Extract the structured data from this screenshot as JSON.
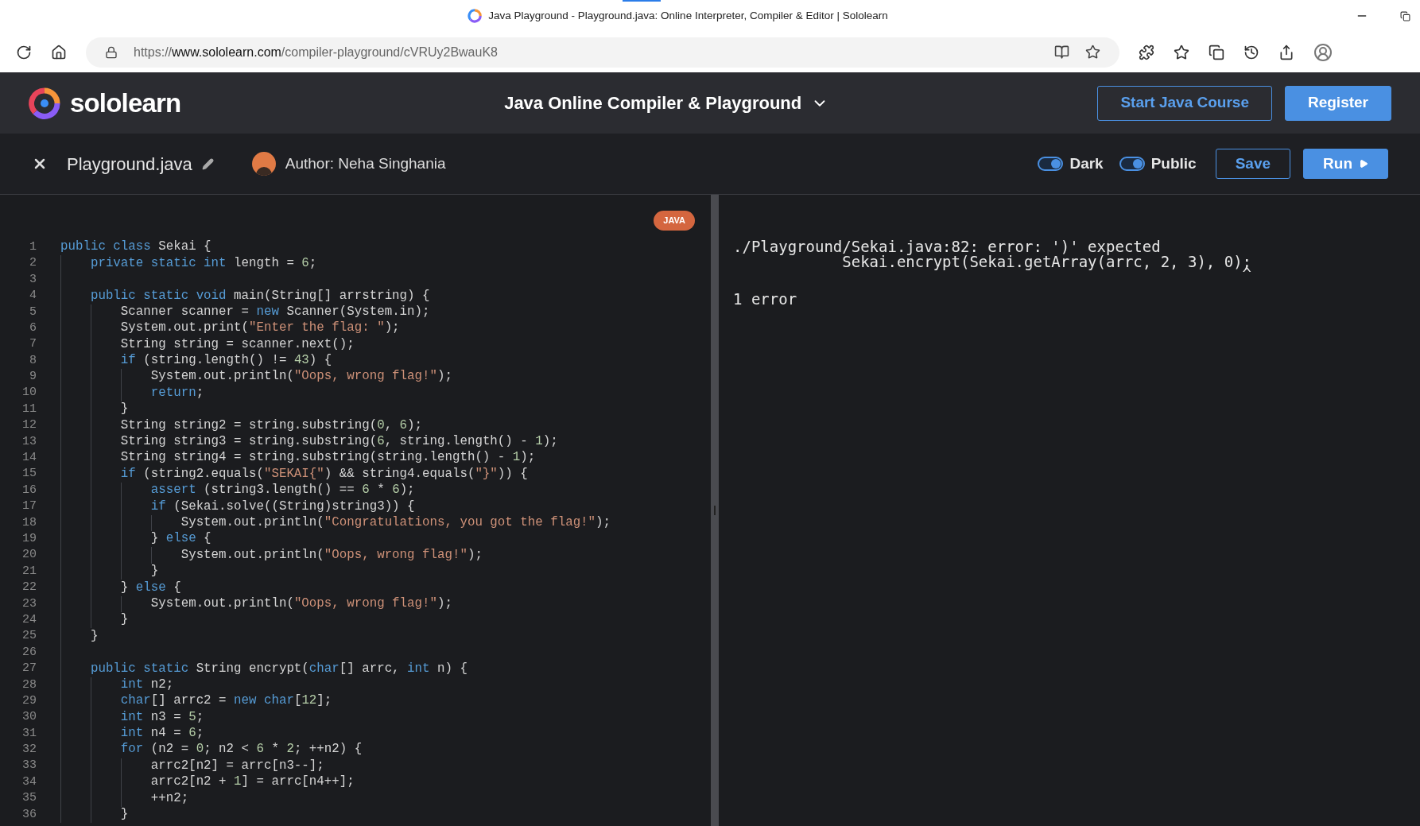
{
  "browser": {
    "title": "Java Playground - Playground.java: Online Interpreter, Compiler & Editor | Sololearn",
    "url_prefix": "https://",
    "url_host": "www.sololearn.com",
    "url_path": "/compiler-playground/cVRUy2BwauK8"
  },
  "header": {
    "brand": "sololearn",
    "title": "Java Online Compiler & Playground",
    "buttons": [
      {
        "label": "Start Java Course",
        "kind": "outline"
      },
      {
        "label": "Register",
        "kind": "filled"
      }
    ]
  },
  "toolbar": {
    "file_name": "Playground.java",
    "author": "Author: Neha Singhania",
    "toggles": [
      {
        "label": "Dark",
        "on": true
      },
      {
        "label": "Public",
        "on": true
      }
    ],
    "buttons": [
      {
        "label": "Save",
        "kind": "outline"
      },
      {
        "label": "Run",
        "kind": "filled"
      }
    ]
  },
  "editor": {
    "language_badge": "JAVA",
    "lines": [
      {
        "number": "1",
        "tokens": [
          {
            "kind": "keyword",
            "text": "public class"
          },
          {
            "kind": "text",
            "text": " Sekai {"
          }
        ]
      },
      {
        "number": "2",
        "tokens": [
          {
            "kind": "keyword",
            "text": "    private static int"
          },
          {
            "kind": "text",
            "text": " length = "
          },
          {
            "kind": "number",
            "text": "6"
          },
          {
            "kind": "text",
            "text": ";"
          }
        ]
      },
      {
        "number": "3"
      },
      {
        "number": "4",
        "tokens": [
          {
            "kind": "keyword",
            "text": "    public static void"
          },
          {
            "kind": "text",
            "text": " main(String[] arrstring) {"
          }
        ]
      },
      {
        "number": "5",
        "tokens": [
          {
            "kind": "text",
            "text": "        Scanner scanner = "
          },
          {
            "kind": "keyword",
            "text": "new"
          },
          {
            "kind": "text",
            "text": " Scanner(System.in);"
          }
        ]
      },
      {
        "number": "6",
        "tokens": [
          {
            "kind": "text",
            "text": "        System.out.print("
          },
          {
            "kind": "string",
            "text": "\"Enter the flag: \""
          },
          {
            "kind": "text",
            "text": ");"
          }
        ]
      },
      {
        "number": "7",
        "tokens": [
          {
            "kind": "text",
            "text": "        String string = scanner.next();"
          }
        ]
      },
      {
        "number": "8",
        "tokens": [
          {
            "kind": "keyword",
            "text": "        if"
          },
          {
            "kind": "text",
            "text": " (string.length() != "
          },
          {
            "kind": "number",
            "text": "43"
          },
          {
            "kind": "text",
            "text": ") {"
          }
        ]
      },
      {
        "number": "9",
        "tokens": [
          {
            "kind": "text",
            "text": "            System.out.println("
          },
          {
            "kind": "string",
            "text": "\"Oops, wrong flag!\""
          },
          {
            "kind": "text",
            "text": ");"
          }
        ]
      },
      {
        "number": "10",
        "tokens": [
          {
            "kind": "keyword",
            "text": "            return"
          },
          {
            "kind": "text",
            "text": ";"
          }
        ]
      },
      {
        "number": "11",
        "tokens": [
          {
            "kind": "text",
            "text": "        }"
          }
        ]
      },
      {
        "number": "12",
        "tokens": [
          {
            "kind": "text",
            "text": "        String string2 = string.substring("
          },
          {
            "kind": "number",
            "text": "0"
          },
          {
            "kind": "text",
            "text": ", "
          },
          {
            "kind": "number",
            "text": "6"
          },
          {
            "kind": "text",
            "text": ");"
          }
        ]
      },
      {
        "number": "13",
        "tokens": [
          {
            "kind": "text",
            "text": "        String string3 = string.substring("
          },
          {
            "kind": "number",
            "text": "6"
          },
          {
            "kind": "text",
            "text": ", string.length() - "
          },
          {
            "kind": "number",
            "text": "1"
          },
          {
            "kind": "text",
            "text": ");"
          }
        ]
      },
      {
        "number": "14",
        "tokens": [
          {
            "kind": "text",
            "text": "        String string4 = string.substring(string.length() - "
          },
          {
            "kind": "number",
            "text": "1"
          },
          {
            "kind": "text",
            "text": ");"
          }
        ]
      },
      {
        "number": "15",
        "tokens": [
          {
            "kind": "keyword",
            "text": "        if"
          },
          {
            "kind": "text",
            "text": " (string2.equals("
          },
          {
            "kind": "string",
            "text": "\"SEKAI{\""
          },
          {
            "kind": "text",
            "text": ") && string4.equals("
          },
          {
            "kind": "string",
            "text": "\"}\""
          },
          {
            "kind": "text",
            "text": ")) {"
          }
        ]
      },
      {
        "number": "16",
        "tokens": [
          {
            "kind": "keyword",
            "text": "            assert"
          },
          {
            "kind": "text",
            "text": " (string3.length() == "
          },
          {
            "kind": "number",
            "text": "6"
          },
          {
            "kind": "text",
            "text": " * "
          },
          {
            "kind": "number",
            "text": "6"
          },
          {
            "kind": "text",
            "text": ");"
          }
        ]
      },
      {
        "number": "17",
        "tokens": [
          {
            "kind": "keyword",
            "text": "            if"
          },
          {
            "kind": "text",
            "text": " (Sekai.solve((String)string3)) {"
          }
        ]
      },
      {
        "number": "18",
        "tokens": [
          {
            "kind": "text",
            "text": "                System.out.println("
          },
          {
            "kind": "string",
            "text": "\"Congratulations, you got the flag!\""
          },
          {
            "kind": "text",
            "text": ");"
          }
        ]
      },
      {
        "number": "19",
        "tokens": [
          {
            "kind": "text",
            "text": "            } "
          },
          {
            "kind": "keyword",
            "text": "else"
          },
          {
            "kind": "text",
            "text": " {"
          }
        ]
      },
      {
        "number": "20",
        "tokens": [
          {
            "kind": "text",
            "text": "                System.out.println("
          },
          {
            "kind": "string",
            "text": "\"Oops, wrong flag!\""
          },
          {
            "kind": "text",
            "text": ");"
          }
        ]
      },
      {
        "number": "21",
        "tokens": [
          {
            "kind": "text",
            "text": "            }"
          }
        ]
      },
      {
        "number": "22",
        "tokens": [
          {
            "kind": "text",
            "text": "        } "
          },
          {
            "kind": "keyword",
            "text": "else"
          },
          {
            "kind": "text",
            "text": " {"
          }
        ]
      },
      {
        "number": "23",
        "tokens": [
          {
            "kind": "text",
            "text": "            System.out.println("
          },
          {
            "kind": "string",
            "text": "\"Oops, wrong flag!\""
          },
          {
            "kind": "text",
            "text": ");"
          }
        ]
      },
      {
        "number": "24",
        "tokens": [
          {
            "kind": "text",
            "text": "        }"
          }
        ]
      },
      {
        "number": "25",
        "tokens": [
          {
            "kind": "text",
            "text": "    }"
          }
        ]
      },
      {
        "number": "26"
      },
      {
        "number": "27",
        "tokens": [
          {
            "kind": "keyword",
            "text": "    public static"
          },
          {
            "kind": "text",
            "text": " String encrypt("
          },
          {
            "kind": "keyword",
            "text": "char"
          },
          {
            "kind": "text",
            "text": "[] arrc, "
          },
          {
            "kind": "keyword",
            "text": "int"
          },
          {
            "kind": "text",
            "text": " n) {"
          }
        ]
      },
      {
        "number": "28",
        "tokens": [
          {
            "kind": "keyword",
            "text": "        int"
          },
          {
            "kind": "text",
            "text": " n2;"
          }
        ]
      },
      {
        "number": "29",
        "tokens": [
          {
            "kind": "keyword",
            "text": "        char"
          },
          {
            "kind": "text",
            "text": "[] arrc2 = "
          },
          {
            "kind": "keyword",
            "text": "new char"
          },
          {
            "kind": "text",
            "text": "["
          },
          {
            "kind": "number",
            "text": "12"
          },
          {
            "kind": "text",
            "text": "];"
          }
        ]
      },
      {
        "number": "30",
        "tokens": [
          {
            "kind": "keyword",
            "text": "        int"
          },
          {
            "kind": "text",
            "text": " n3 = "
          },
          {
            "kind": "number",
            "text": "5"
          },
          {
            "kind": "text",
            "text": ";"
          }
        ]
      },
      {
        "number": "31",
        "tokens": [
          {
            "kind": "keyword",
            "text": "        int"
          },
          {
            "kind": "text",
            "text": " n4 = "
          },
          {
            "kind": "number",
            "text": "6"
          },
          {
            "kind": "text",
            "text": ";"
          }
        ]
      },
      {
        "number": "32",
        "tokens": [
          {
            "kind": "keyword",
            "text": "        for"
          },
          {
            "kind": "text",
            "text": " (n2 = "
          },
          {
            "kind": "number",
            "text": "0"
          },
          {
            "kind": "text",
            "text": "; n2 < "
          },
          {
            "kind": "number",
            "text": "6"
          },
          {
            "kind": "text",
            "text": " * "
          },
          {
            "kind": "number",
            "text": "2"
          },
          {
            "kind": "text",
            "text": "; ++n2) {"
          }
        ]
      },
      {
        "number": "33",
        "tokens": [
          {
            "kind": "text",
            "text": "            arrc2[n2] = arrc[n3--];"
          }
        ]
      },
      {
        "number": "34",
        "tokens": [
          {
            "kind": "text",
            "text": "            arrc2[n2 + "
          },
          {
            "kind": "number",
            "text": "1"
          },
          {
            "kind": "text",
            "text": "] = arrc[n4++];"
          }
        ]
      },
      {
        "number": "35",
        "tokens": [
          {
            "kind": "text",
            "text": "            ++n2;"
          }
        ]
      },
      {
        "number": "36",
        "tokens": [
          {
            "kind": "text",
            "text": "        }"
          }
        ]
      }
    ]
  },
  "output": {
    "lines": [
      "./Playground/Sekai.java:82: error: ')' expected",
      "            Sekai.encrypt(Sekai.getArray(arrc, 2, 3), 0);",
      "                                                        ^",
      "1 error"
    ]
  }
}
